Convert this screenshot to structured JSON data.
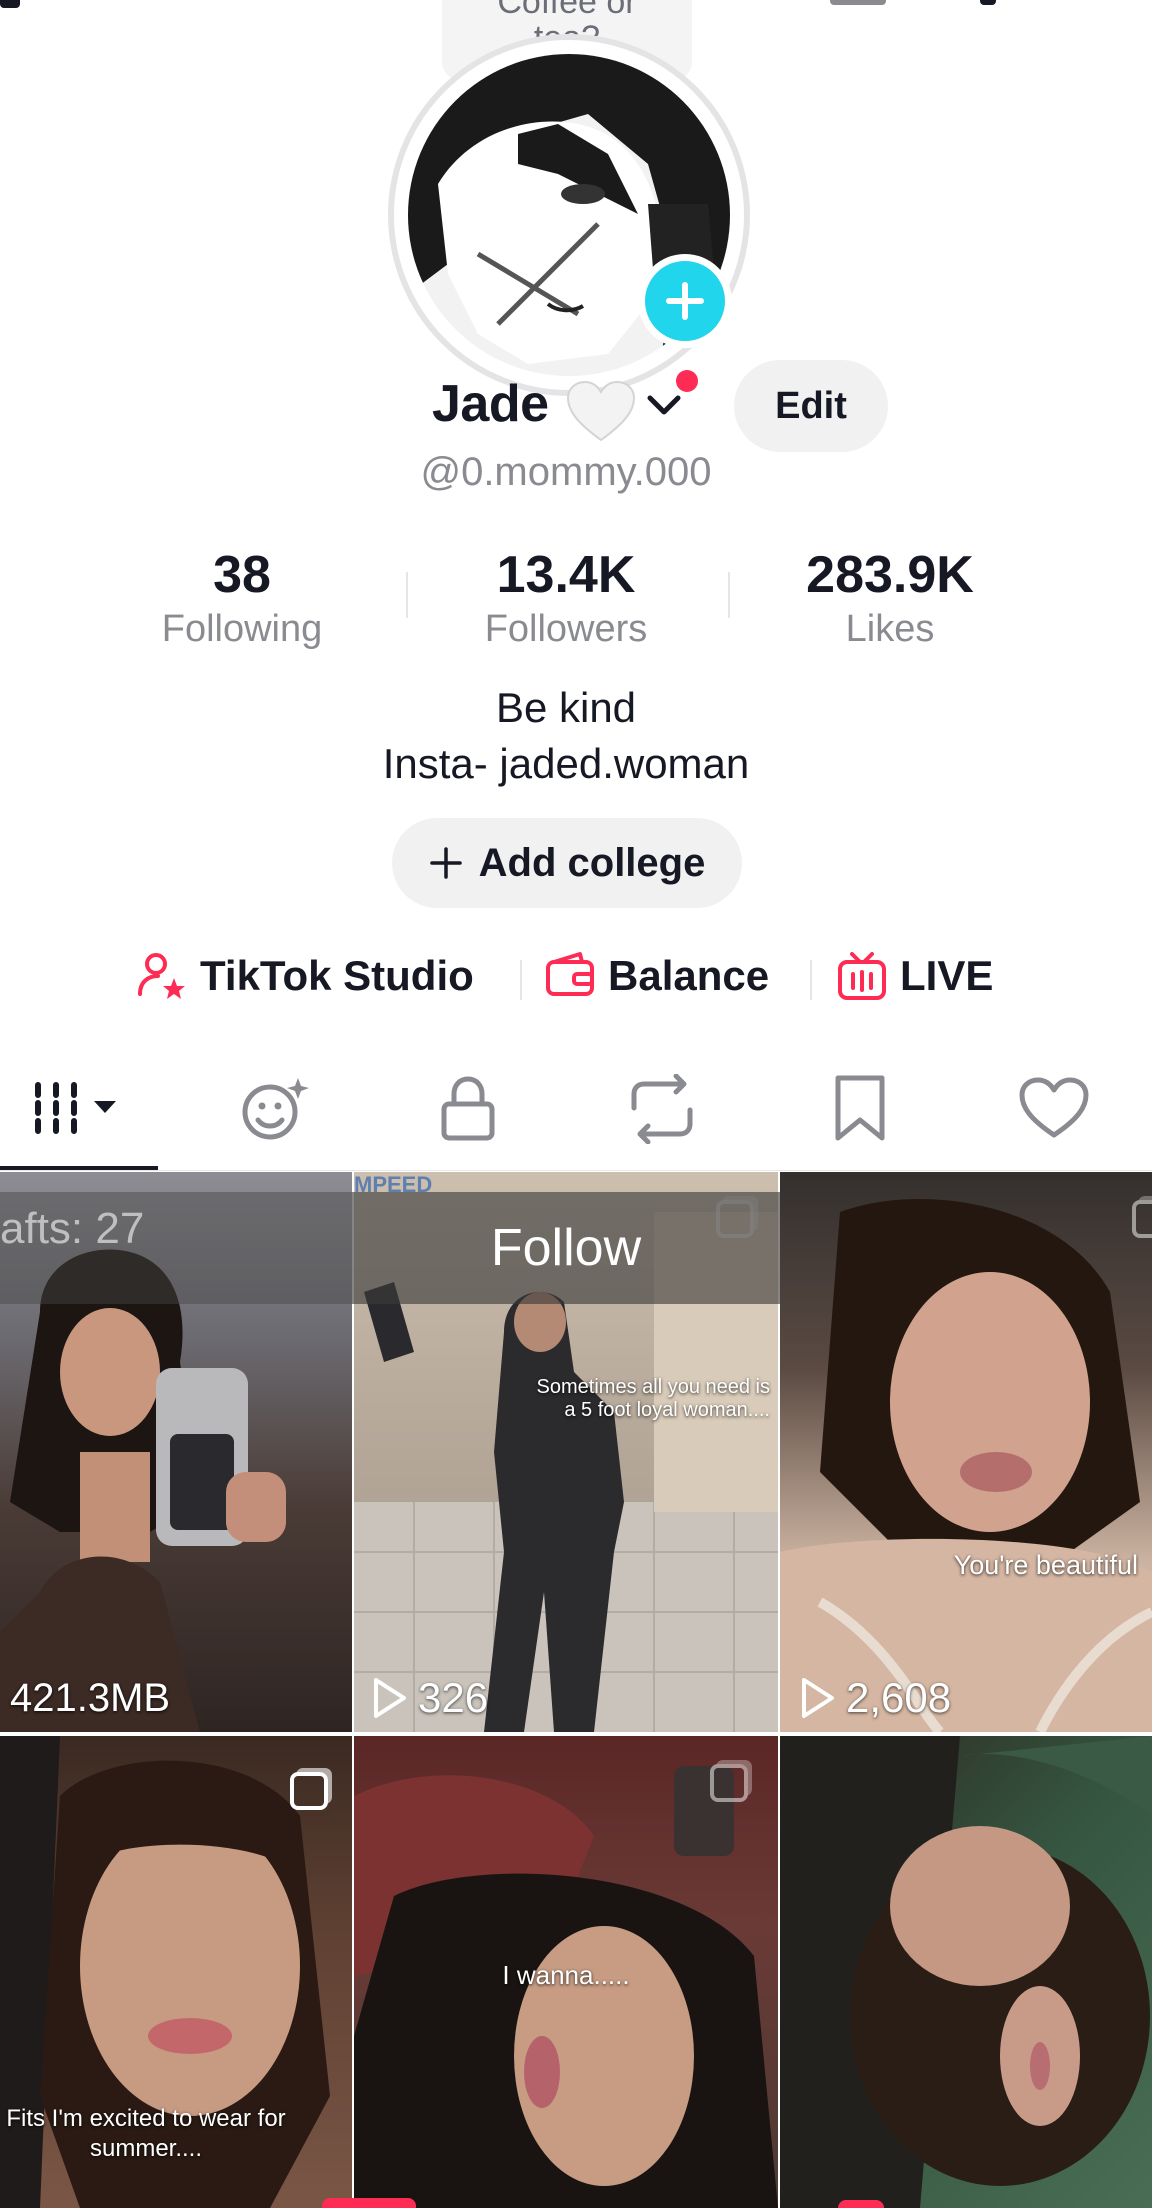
{
  "status_bubble": {
    "line1": "Coffee or",
    "line2": "tea?"
  },
  "profile": {
    "name": "Jade",
    "handle": "@0.mommy.000",
    "edit_label": "Edit"
  },
  "stats": [
    {
      "value": "38",
      "label": "Following"
    },
    {
      "value": "13.4K",
      "label": "Followers"
    },
    {
      "value": "283.9K",
      "label": "Likes"
    }
  ],
  "bio": {
    "line1": "Be kind",
    "line2": "Insta- jaded.woman"
  },
  "add_college_label": "Add college",
  "tools": {
    "studio": "TikTok Studio",
    "balance": "Balance",
    "live": "LIVE"
  },
  "tabs": [
    "videos-icon",
    "collaborations-icon",
    "private-icon",
    "reposts-icon",
    "favorites-icon",
    "liked-icon"
  ],
  "grid": {
    "drafts": "afts: 27",
    "follow_overlay": "Follow",
    "tiles": [
      {
        "caption": "",
        "stat": "421.3MB"
      },
      {
        "caption": "Sometimes all you need is a 5 foot loyal woman....",
        "stat": "326"
      },
      {
        "caption": "You're beautiful",
        "stat": "2,608"
      },
      {
        "caption": "Fits I'm excited to wear for summer....",
        "stat": ""
      },
      {
        "caption": "I wanna.....",
        "stat": ""
      },
      {
        "caption": "",
        "stat": ""
      }
    ],
    "watermark": "MPEED"
  },
  "colors": {
    "accent": "#fe2c55",
    "plus": "#20d5ec",
    "text": "#161823",
    "secondary": "#8a8b91"
  }
}
